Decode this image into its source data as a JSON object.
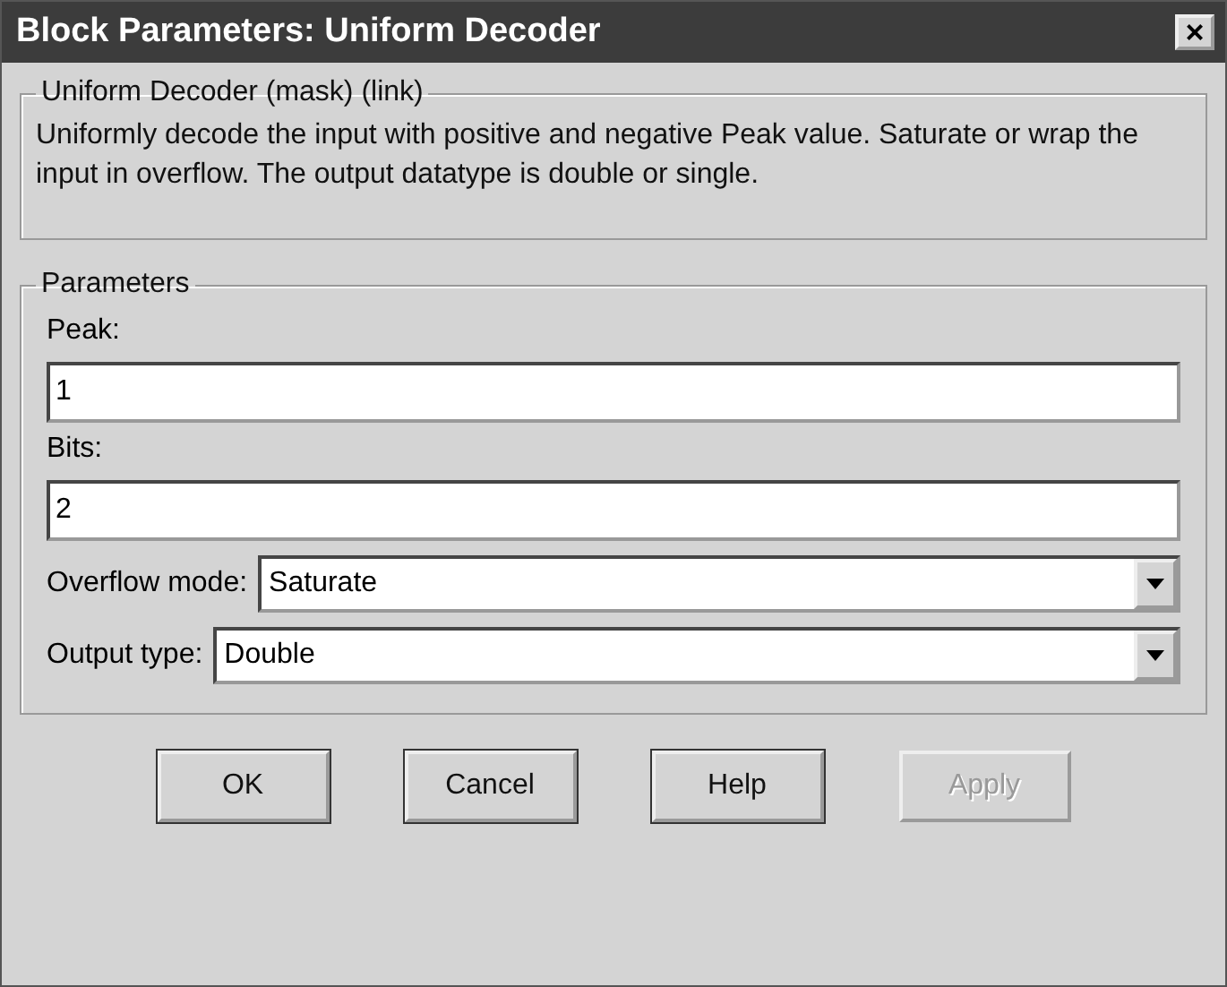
{
  "window": {
    "title": "Block Parameters: Uniform Decoder",
    "close": "×"
  },
  "description_group": {
    "title": "Uniform Decoder (mask) (link)",
    "text": "Uniformly decode the input with positive and negative Peak value. Saturate or wrap the input in overflow.  The  output datatype is double or single."
  },
  "parameters_group": {
    "title": "Parameters",
    "fields": [
      {
        "kind": "text",
        "label": "Peak:",
        "value": "1"
      },
      {
        "kind": "text",
        "label": "Bits:",
        "value": "2"
      },
      {
        "kind": "dropdown",
        "label": "Overflow mode:",
        "value": "Saturate"
      },
      {
        "kind": "dropdown",
        "label": "Output type:",
        "value": "Double"
      }
    ]
  },
  "buttons": [
    {
      "label": "OK",
      "disabled": false
    },
    {
      "label": "Cancel",
      "disabled": false
    },
    {
      "label": "Help",
      "disabled": false
    },
    {
      "label": "Apply",
      "disabled": true
    }
  ]
}
